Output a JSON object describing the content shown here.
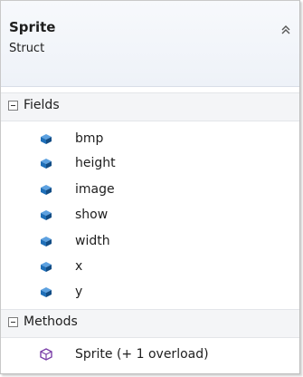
{
  "header": {
    "title": "Sprite",
    "subtitle": "Struct"
  },
  "sections": {
    "fields": {
      "label": "Fields",
      "items": [
        "bmp",
        "height",
        "image",
        "show",
        "width",
        "x",
        "y"
      ]
    },
    "methods": {
      "label": "Methods",
      "items": [
        "Sprite (+ 1 overload)"
      ]
    }
  },
  "colors": {
    "field_icon": "#1f6fb8",
    "method_icon": "#7a3ea8",
    "header_bg": "#f2f5fa",
    "section_bg": "#f4f5f7"
  },
  "icons": {
    "collapse": "double-chevron-up-icon",
    "section_toggle": "minus-box-icon",
    "field": "field-cube-icon",
    "method": "method-cube-icon"
  }
}
